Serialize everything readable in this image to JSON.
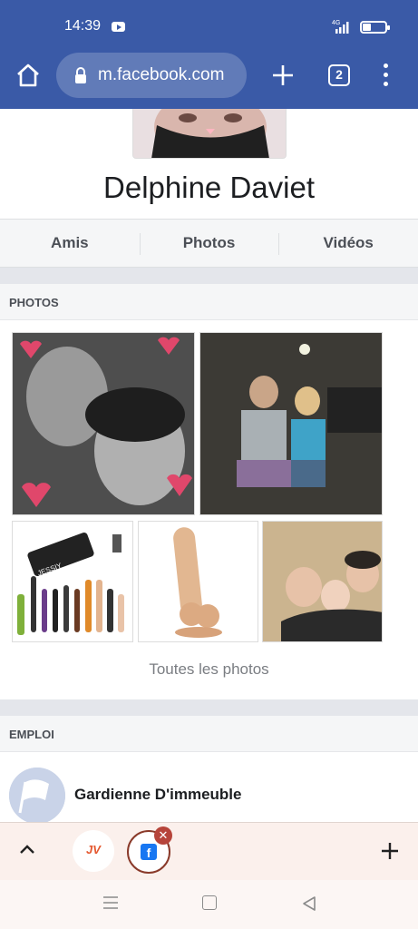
{
  "status_bar": {
    "time": "14:39",
    "network": "4G"
  },
  "browser": {
    "url": "m.facebook.com",
    "tab_count": "2"
  },
  "profile": {
    "name": "Delphine Daviet"
  },
  "tabs": [
    {
      "label": "Amis"
    },
    {
      "label": "Photos"
    },
    {
      "label": "Vidéos"
    }
  ],
  "photos_section": {
    "title": "PHOTOS",
    "see_all": "Toutes les photos",
    "product_brand": "JESSIY"
  },
  "work_section": {
    "title": "EMPLOI",
    "job": "Gardienne D'immeuble"
  },
  "tab_strip": {
    "site1_logo": "JV",
    "site2_logo": "f"
  },
  "colors": {
    "top_bar": "#3a5aa7",
    "section_bg": "#f5f6f7",
    "divider": "#e4e6eb",
    "tab_strip": "#fbf0ec"
  },
  "icons": [
    "home-icon",
    "lock-icon",
    "plus-icon",
    "tabs-icon",
    "menu-icon",
    "chevron-up-icon",
    "close-icon",
    "new-tab-icon",
    "recent-apps-icon",
    "nav-home-icon",
    "back-icon"
  ]
}
